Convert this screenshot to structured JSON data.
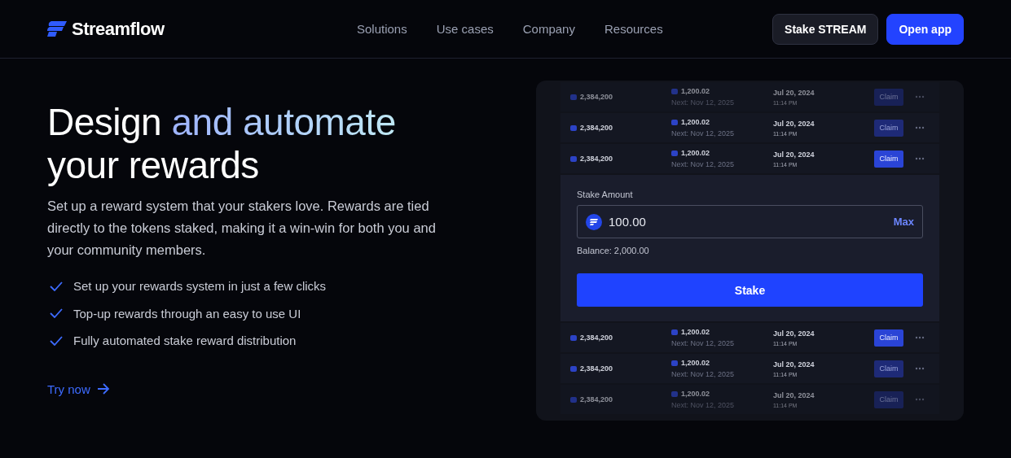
{
  "nav": {
    "brand": "Streamflow",
    "links": [
      "Solutions",
      "Use cases",
      "Company",
      "Resources"
    ],
    "buttons": [
      {
        "label": "Stake STREAM",
        "kind": "secondary"
      },
      {
        "label": "Open app",
        "kind": "primary"
      }
    ]
  },
  "hero": {
    "title_plain": "Design ",
    "title_gradient": "and automate",
    "title_rest": "your rewards",
    "description": "Set up a reward system that your stakers love. Rewards are tied directly to the tokens staked, making it a win-win for both you and your community members.",
    "features": [
      "Set up your rewards system in just a few clicks",
      "Top-up rewards through an easy to use UI",
      "Fully automated stake reward distribution"
    ],
    "cta": "Try now"
  },
  "rows_top": [
    {
      "amount": "2,384,200",
      "reward": "1,200.02",
      "next": "Next: Nov 12, 2025",
      "date": "Jul 20, 2024",
      "time": "11:14 PM",
      "claim": "Claim",
      "faded": true,
      "highlighted": false
    },
    {
      "amount": "2,384,200",
      "reward": "1,200.02",
      "next": "Next: Nov 12, 2025",
      "date": "Jul 20, 2024",
      "time": "11:14 PM",
      "claim": "Claim",
      "faded": false,
      "highlighted": false
    },
    {
      "amount": "2,384,200",
      "reward": "1,200.02",
      "next": "Next: Nov 12, 2025",
      "date": "Jul 20, 2024",
      "time": "11:14 PM",
      "claim": "Claim",
      "faded": false,
      "highlighted": true
    }
  ],
  "stake": {
    "label": "Stake Amount",
    "value": "100.00",
    "max": "Max",
    "balance": "Balance: 2,000.00",
    "button": "Stake"
  },
  "rows_bottom": [
    {
      "amount": "2,384,200",
      "reward": "1,200.02",
      "next": "Next: Nov 12, 2025",
      "date": "Jul 20, 2024",
      "time": "11:14 PM",
      "claim": "Claim",
      "faded": false,
      "highlighted": true
    },
    {
      "amount": "2,384,200",
      "reward": "1,200.02",
      "next": "Next: Nov 12, 2025",
      "date": "Jul 20, 2024",
      "time": "11:14 PM",
      "claim": "Claim",
      "faded": false,
      "highlighted": false
    },
    {
      "amount": "2,384,200",
      "reward": "1,200.02",
      "next": "Next: Nov 12, 2025",
      "date": "Jul 20, 2024",
      "time": "11:14 PM",
      "claim": "Claim",
      "faded": true,
      "highlighted": false
    }
  ]
}
